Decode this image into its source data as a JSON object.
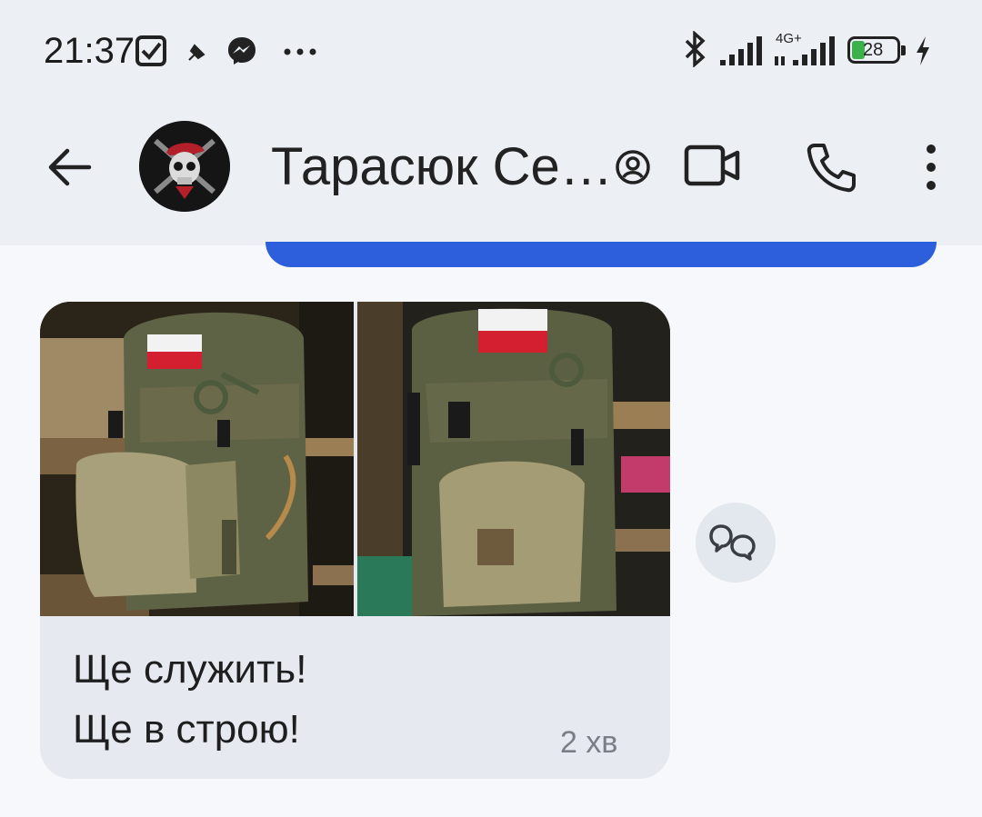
{
  "status_bar": {
    "time": "21:37",
    "network_label": "4G+",
    "battery": "28",
    "icons": [
      "checkbox-icon",
      "pin-icon",
      "messenger-icon",
      "more-dots-icon",
      "bluetooth-icon",
      "signal-icon",
      "signal-icon",
      "battery-icon",
      "charging-icon"
    ]
  },
  "header": {
    "contact_name": "Тарасюк Се…",
    "icons": [
      "back-arrow-icon",
      "avatar",
      "account-icon",
      "video-call-icon",
      "phone-icon",
      "more-vert-icon"
    ]
  },
  "message": {
    "lines": [
      "Ще служить!",
      "Ще в строю!"
    ],
    "time": "2 хв",
    "photos": [
      "backpack-photo-1",
      "backpack-photo-2"
    ]
  },
  "colors": {
    "header_bg": "#eceff4",
    "accent_blue": "#2d5fdc",
    "bubble_bg": "#e6e9ef",
    "page_bg": "#f6f8fb"
  }
}
